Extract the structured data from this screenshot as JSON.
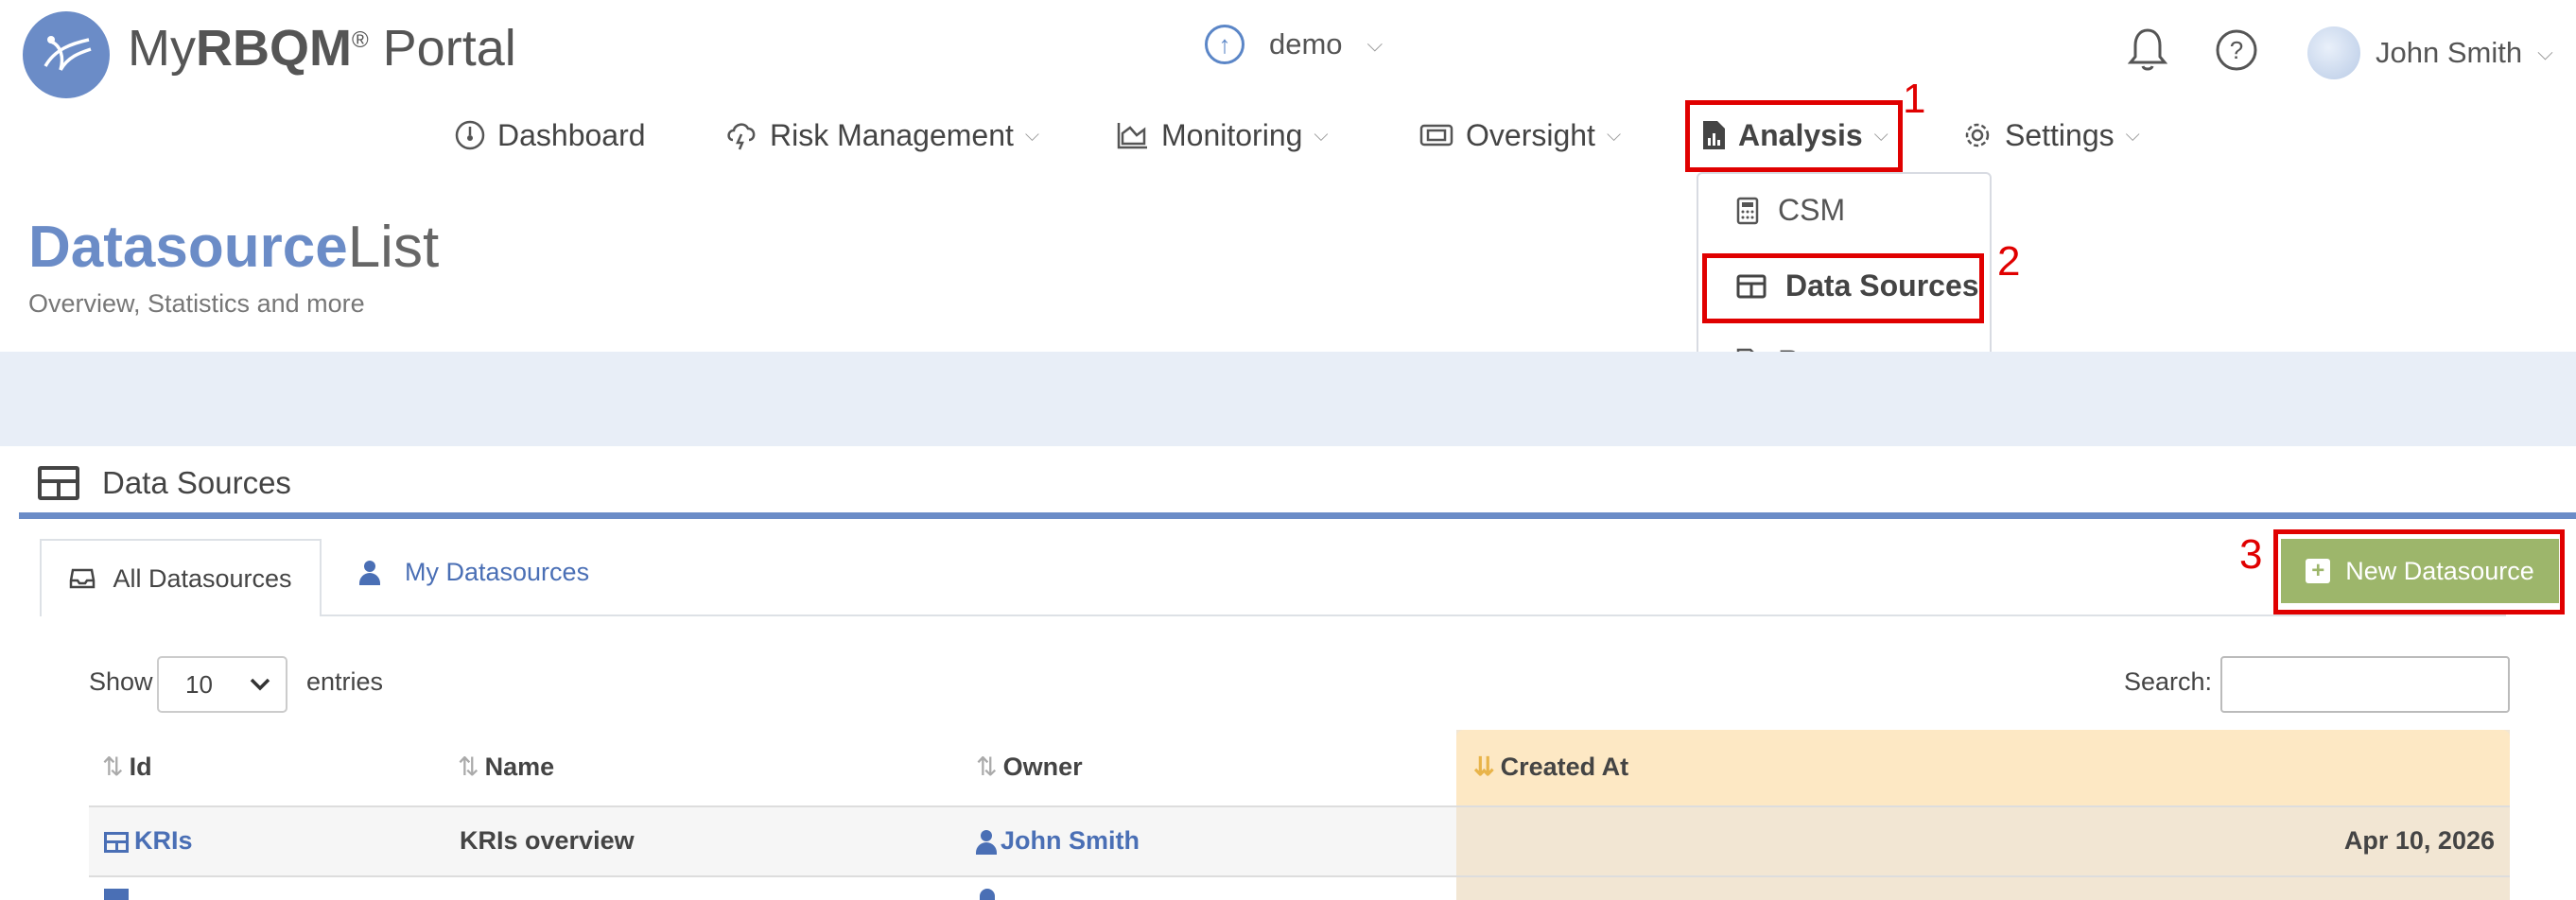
{
  "header": {
    "logo_prefix": "My",
    "logo_bold": "RBQM",
    "logo_reg": "®",
    "logo_suffix": " Portal",
    "project": "demo",
    "user_name": "John Smith"
  },
  "nav": {
    "dashboard": "Dashboard",
    "risk_management": "Risk Management",
    "monitoring": "Monitoring",
    "oversight": "Oversight",
    "analysis": "Analysis",
    "settings": "Settings"
  },
  "dropdown": {
    "csm": "CSM",
    "data_sources": "Data Sources",
    "reports": "Reports"
  },
  "annotations": {
    "n1": "1",
    "n2": "2",
    "n3": "3"
  },
  "page": {
    "title_bold": "Datasource",
    "title_light": "List",
    "subtitle": "Overview, Statistics and more"
  },
  "panel": {
    "title": "Data Sources",
    "tab_all": "All Datasources",
    "tab_mine": "My Datasources",
    "new_button": "New Datasource"
  },
  "controls": {
    "show": "Show",
    "entries_value": "10",
    "entries": "entries",
    "search": "Search:"
  },
  "table": {
    "headers": [
      "Id",
      "Name",
      "Owner",
      "Created At"
    ],
    "rows": [
      {
        "id": "KRIs",
        "name": "KRIs overview",
        "owner": "John Smith",
        "created": "Apr 10, 2026"
      }
    ]
  },
  "colors": {
    "accent": "#6b8cc7",
    "highlight": "#e00000",
    "button_green": "#9db66b",
    "sorted_header": "#fde8c4"
  }
}
